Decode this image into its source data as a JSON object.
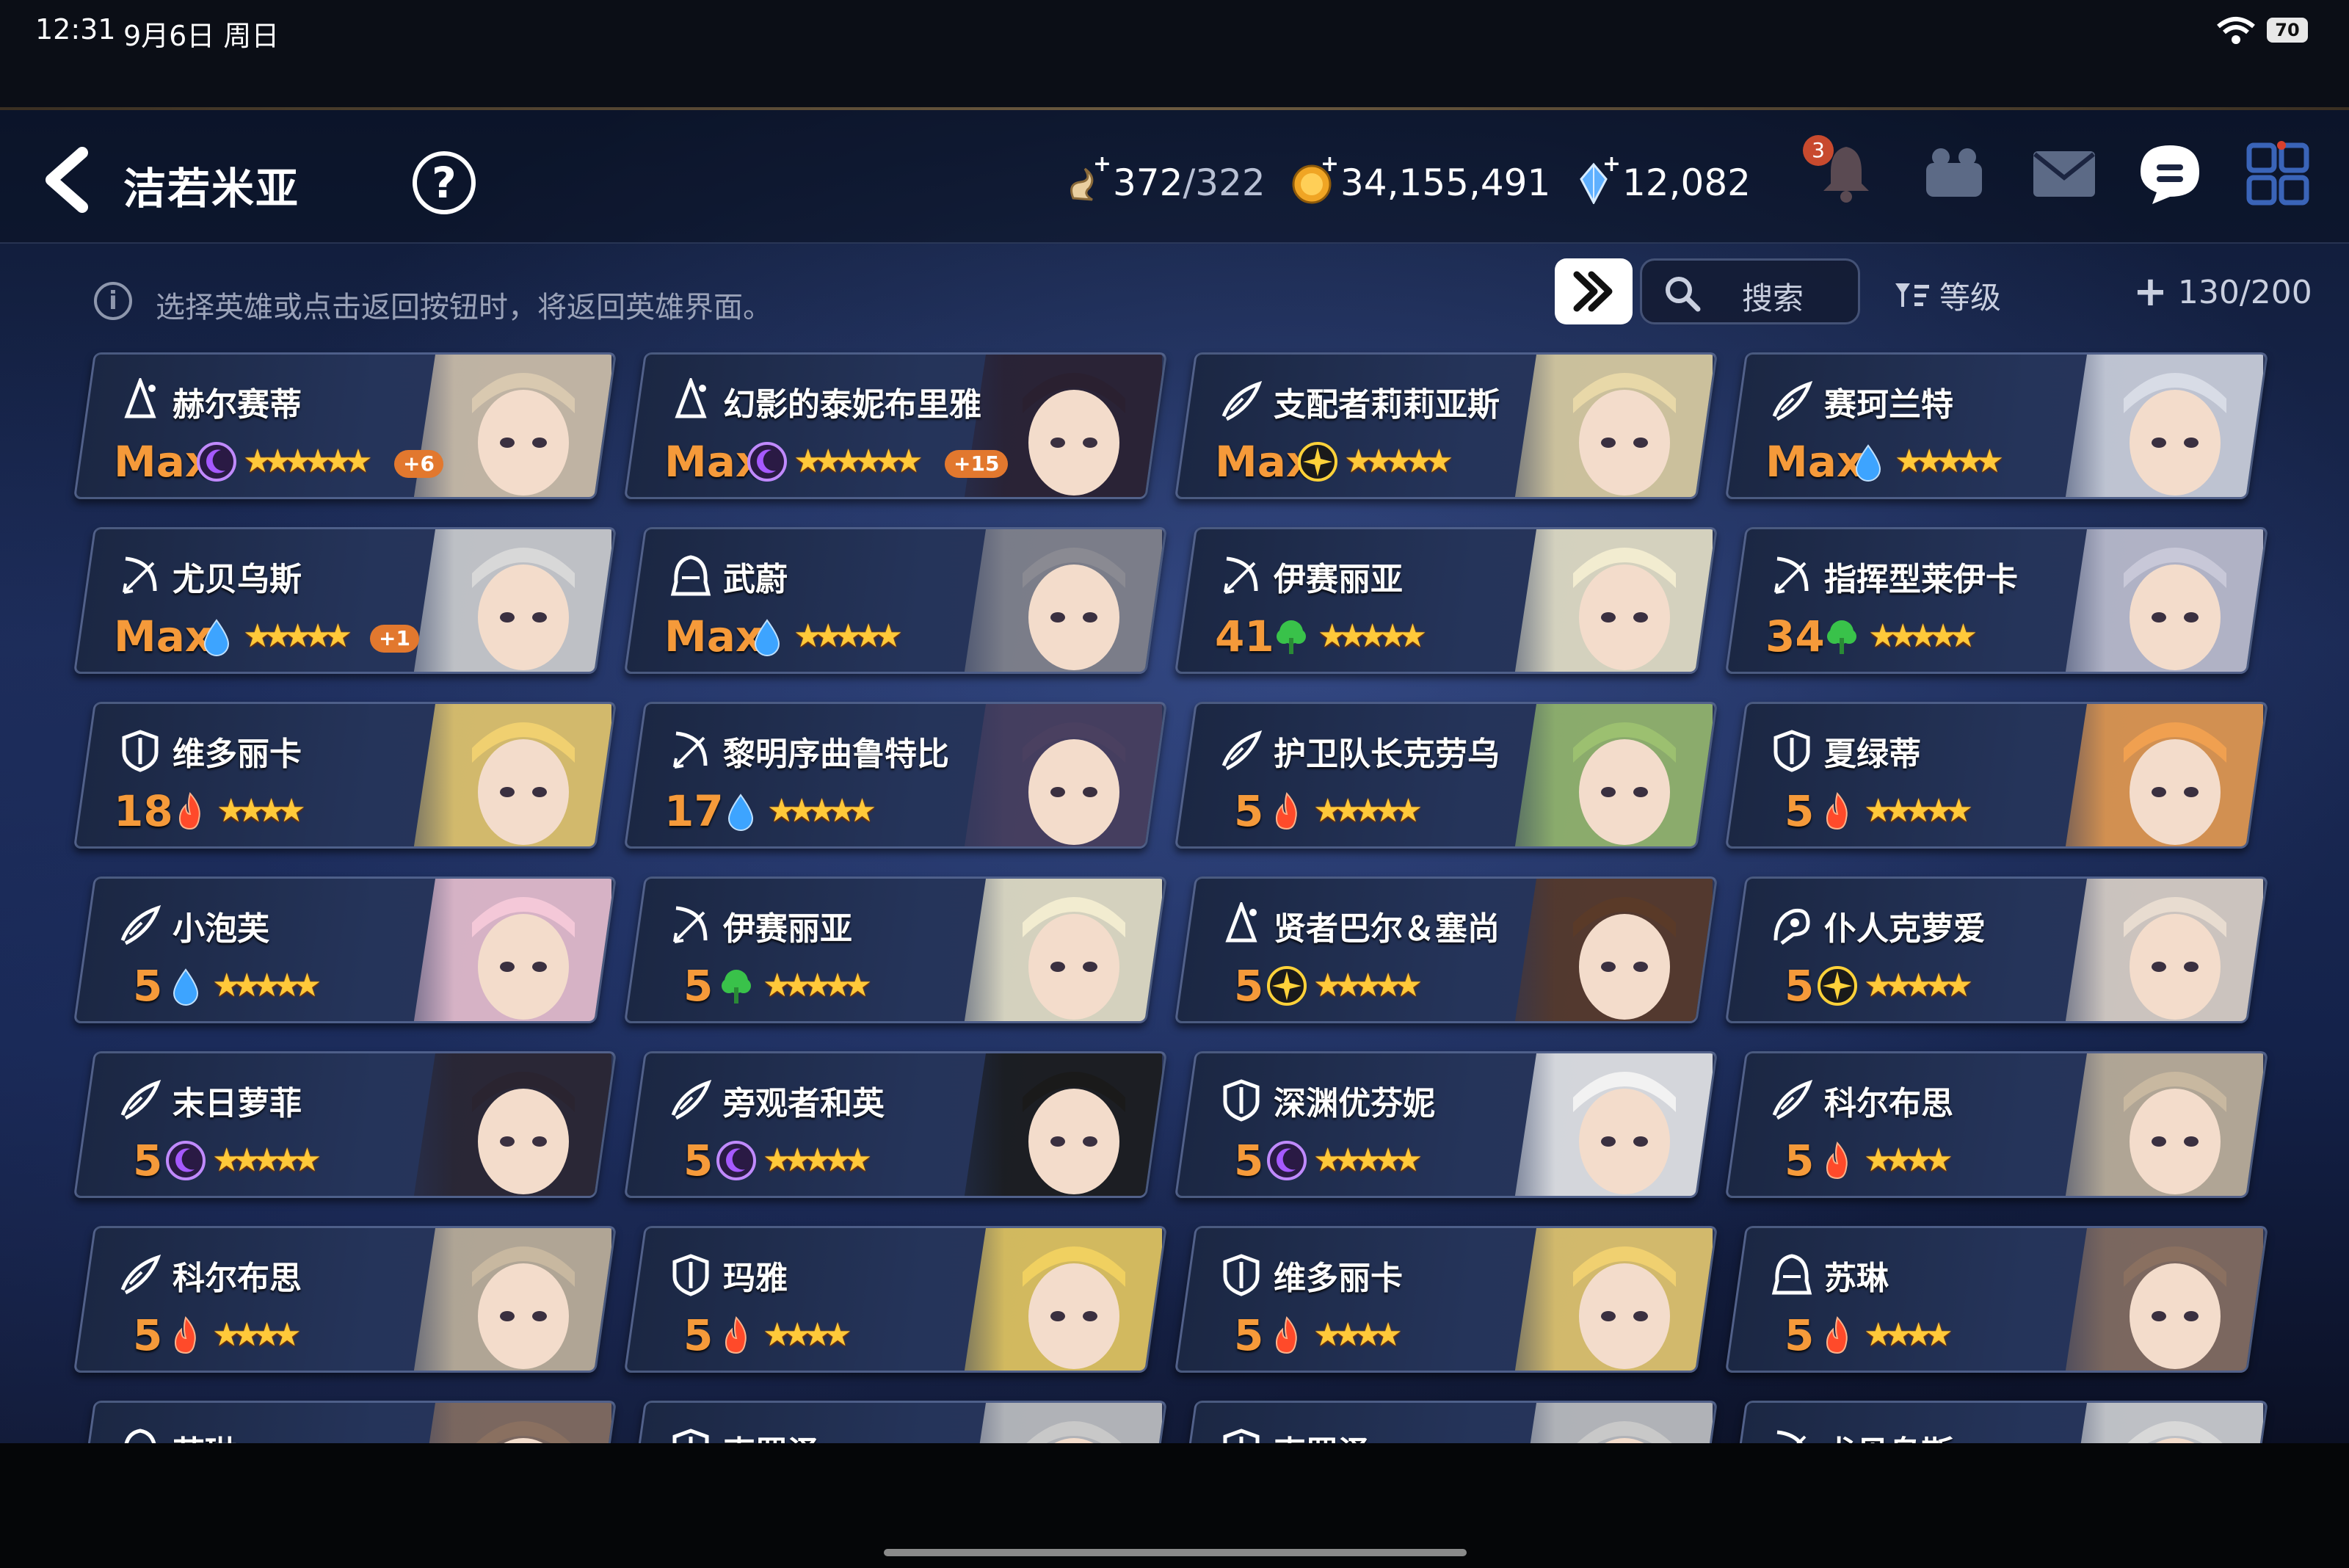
{
  "status_bar": {
    "time": "12:31",
    "date": "9月6日 周日",
    "battery": "70"
  },
  "header": {
    "title": "洁若米亚",
    "help_label": "?",
    "resources": {
      "stamina": {
        "value": "372",
        "cap": "/322"
      },
      "gold": {
        "value": "34,155,491"
      },
      "crystal": {
        "value": "12,082"
      }
    },
    "notice_count": "3",
    "icons": [
      "back-icon",
      "help-icon",
      "stamina-icon",
      "gold-icon",
      "crystal-icon",
      "bell-icon",
      "team-icon",
      "mail-icon",
      "chat-icon",
      "menu-grid-icon"
    ]
  },
  "toolbar": {
    "hint": "选择英雄或点击返回按钮时，将返回英雄界面。",
    "search_label": "搜索",
    "sort_label": "等级",
    "capacity": "130/200"
  },
  "colors": {
    "level": "#f59a3a",
    "star": "#ffc93a",
    "moon": "#a659ff",
    "light": "#ffd23a",
    "water": "#3da4ff",
    "earth": "#39c24a",
    "fire": "#ff4a2a"
  },
  "heroes": [
    {
      "name": "赫尔赛蒂",
      "level": "Max",
      "attr": "moon",
      "stars": "★★★★★★",
      "plus": "+6",
      "cls": "mage"
    },
    {
      "name": "幻影的泰妮布里雅",
      "level": "Max",
      "attr": "moon",
      "stars": "★★★★★★",
      "plus": "+15",
      "cls": "mage"
    },
    {
      "name": "支配者莉莉亚斯",
      "level": "Max",
      "attr": "light",
      "stars": "★★★★★",
      "plus": "",
      "cls": "knight"
    },
    {
      "name": "赛珂兰特",
      "level": "Max",
      "attr": "water",
      "stars": "★★★★★",
      "plus": "",
      "cls": "knight"
    },
    {
      "name": "尤贝乌斯",
      "level": "Max",
      "attr": "water",
      "stars": "★★★★★",
      "plus": "+1",
      "cls": "ranger"
    },
    {
      "name": "武蔚",
      "level": "Max",
      "attr": "water",
      "stars": "★★★★★",
      "plus": "",
      "cls": "thief"
    },
    {
      "name": "伊赛丽亚",
      "level": "41",
      "attr": "earth",
      "stars": "★★★★★",
      "plus": "",
      "cls": "ranger"
    },
    {
      "name": "指挥型莱伊卡",
      "level": "34",
      "attr": "earth",
      "stars": "★★★★★",
      "plus": "",
      "cls": "ranger"
    },
    {
      "name": "维多丽卡",
      "level": "18",
      "attr": "fire",
      "stars": "★★★★",
      "plus": "",
      "cls": "warrior"
    },
    {
      "name": "黎明序曲鲁特比",
      "level": "17",
      "attr": "water",
      "stars": "★★★★★",
      "plus": "",
      "cls": "ranger"
    },
    {
      "name": "护卫队长克劳乌",
      "level": "5",
      "attr": "fire",
      "stars": "★★★★★",
      "plus": "",
      "cls": "knight"
    },
    {
      "name": "夏绿蒂",
      "level": "5",
      "attr": "fire",
      "stars": "★★★★★",
      "plus": "",
      "cls": "warrior"
    },
    {
      "name": "小泡芙",
      "level": "5",
      "attr": "water",
      "stars": "★★★★★",
      "plus": "",
      "cls": "knight"
    },
    {
      "name": "伊赛丽亚",
      "level": "5",
      "attr": "earth",
      "stars": "★★★★★",
      "plus": "",
      "cls": "ranger"
    },
    {
      "name": "贤者巴尔＆塞尚",
      "level": "5",
      "attr": "light",
      "stars": "★★★★★",
      "plus": "",
      "cls": "mage"
    },
    {
      "name": "仆人克萝爱",
      "level": "5",
      "attr": "light",
      "stars": "★★★★★",
      "plus": "",
      "cls": "soul"
    },
    {
      "name": "末日萝菲",
      "level": "5",
      "attr": "moon",
      "stars": "★★★★★",
      "plus": "",
      "cls": "knight"
    },
    {
      "name": "旁观者和英",
      "level": "5",
      "attr": "moon",
      "stars": "★★★★★",
      "plus": "",
      "cls": "knight"
    },
    {
      "name": "深渊优芬妮",
      "level": "5",
      "attr": "moon",
      "stars": "★★★★★",
      "plus": "",
      "cls": "warrior"
    },
    {
      "name": "科尔布思",
      "level": "5",
      "attr": "fire",
      "stars": "★★★★",
      "plus": "",
      "cls": "knight"
    },
    {
      "name": "科尔布思",
      "level": "5",
      "attr": "fire",
      "stars": "★★★★",
      "plus": "",
      "cls": "knight"
    },
    {
      "name": "玛雅",
      "level": "5",
      "attr": "fire",
      "stars": "★★★★",
      "plus": "",
      "cls": "warrior"
    },
    {
      "name": "维多丽卡",
      "level": "5",
      "attr": "fire",
      "stars": "★★★★",
      "plus": "",
      "cls": "warrior"
    },
    {
      "name": "苏琳",
      "level": "5",
      "attr": "fire",
      "stars": "★★★★",
      "plus": "",
      "cls": "thief"
    },
    {
      "name": "苏琳",
      "level": "",
      "attr": "",
      "stars": "",
      "plus": "",
      "cls": "thief"
    },
    {
      "name": "克罗泽",
      "level": "",
      "attr": "",
      "stars": "",
      "plus": "",
      "cls": "warrior"
    },
    {
      "name": "克罗泽",
      "level": "",
      "attr": "",
      "stars": "",
      "plus": "",
      "cls": "warrior"
    },
    {
      "name": "尤贝乌斯",
      "level": "",
      "attr": "",
      "stars": "",
      "plus": "",
      "cls": "ranger"
    }
  ]
}
